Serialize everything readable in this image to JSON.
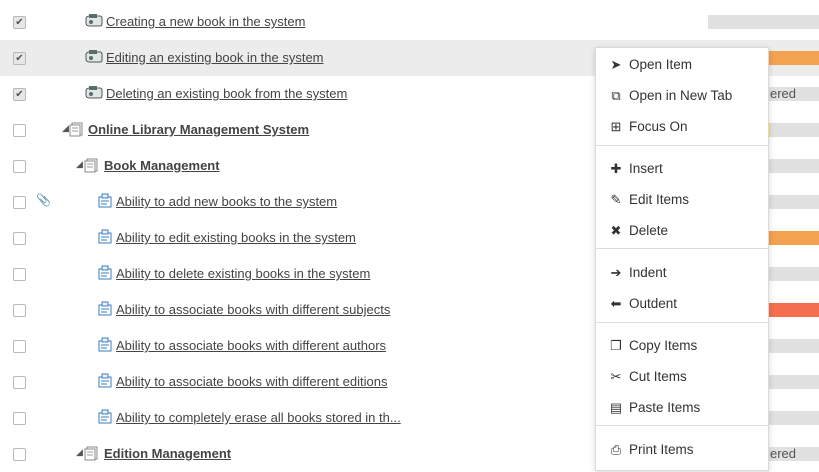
{
  "rows": [
    {
      "checked": true,
      "label": "Creating a new book in the system",
      "icon": "test-case-icon",
      "bar": [],
      "right": ""
    },
    {
      "checked": true,
      "label": "Editing an existing book in the system",
      "icon": "test-case-icon",
      "bar": [
        {
          "color": "#f3a24f",
          "frac": 1
        }
      ],
      "right": ""
    },
    {
      "checked": true,
      "label": "Deleting an existing book from the system",
      "icon": "test-case-icon",
      "bar": [],
      "right": "ered"
    },
    {
      "checked": false,
      "label": "Online Library Management System",
      "icon": "package-icon",
      "bar": [
        {
          "color": "#f36f4f",
          "frac": 0.28
        },
        {
          "color": "#f3a24f",
          "frac": 0.16
        },
        {
          "color": "#f5e34f",
          "frac": 0.12
        }
      ],
      "right": ""
    },
    {
      "checked": false,
      "label": "Book Management",
      "icon": "package-icon",
      "bar": [
        {
          "color": "#f36f4f",
          "frac": 0.35
        },
        {
          "color": "#f3a24f",
          "frac": 0.2
        }
      ],
      "right": ""
    },
    {
      "checked": false,
      "label": "Ability to add new books to the system",
      "icon": "requirement-icon",
      "bar": [
        {
          "color": "#7be36f",
          "frac": 0.55
        }
      ],
      "right": ""
    },
    {
      "checked": false,
      "label": "Ability to edit existing books in the system",
      "icon": "requirement-icon",
      "bar": [
        {
          "color": "#f3a24f",
          "frac": 1
        }
      ],
      "right": ""
    },
    {
      "checked": false,
      "label": "Ability to delete existing books in the system",
      "icon": "requirement-icon",
      "bar": [],
      "right": ""
    },
    {
      "checked": false,
      "label": "Ability to associate books with different subjects",
      "icon": "requirement-icon",
      "bar": [
        {
          "color": "#f36f4f",
          "frac": 1
        }
      ],
      "right": ""
    },
    {
      "checked": false,
      "label": "Ability to associate books with different authors",
      "icon": "requirement-icon",
      "bar": [],
      "right": ""
    },
    {
      "checked": false,
      "label": "Ability to associate books with different editions",
      "icon": "requirement-icon",
      "bar": [
        {
          "color": "#f36f4f",
          "frac": 0.55
        }
      ],
      "right": ""
    },
    {
      "checked": false,
      "label": "Ability to completely erase all books stored in th...",
      "icon": "requirement-icon",
      "bar": [
        {
          "color": "#f36f4f",
          "frac": 0.55
        }
      ],
      "right": ""
    },
    {
      "checked": false,
      "label": "Edition Management",
      "icon": "package-icon",
      "bar": [],
      "right": "ered"
    }
  ],
  "menu": {
    "items": [
      {
        "label": "Open Item",
        "icon": "cursor-arrow-icon",
        "glyph": "➤"
      },
      {
        "label": "Open in New Tab",
        "icon": "external-link-icon",
        "glyph": "⧉"
      },
      {
        "label": "Focus On",
        "icon": "focus-tree-icon",
        "glyph": "⊞"
      },
      {
        "label": "Insert",
        "icon": "plus-icon",
        "glyph": "✚"
      },
      {
        "label": "Edit Items",
        "icon": "edit-icon",
        "glyph": "✎"
      },
      {
        "label": "Delete",
        "icon": "delete-x-icon",
        "glyph": "✖"
      },
      {
        "label": "Indent",
        "icon": "arrow-right-icon",
        "glyph": "➔"
      },
      {
        "label": "Outdent",
        "icon": "arrow-left-icon",
        "glyph": "⬅"
      },
      {
        "label": "Copy Items",
        "icon": "copy-icon",
        "glyph": "❐"
      },
      {
        "label": "Cut Items",
        "icon": "scissors-icon",
        "glyph": "✂"
      },
      {
        "label": "Paste Items",
        "icon": "paste-icon",
        "glyph": "▤"
      },
      {
        "label": "Print Items",
        "icon": "printer-icon",
        "glyph": "⎙"
      }
    ]
  }
}
